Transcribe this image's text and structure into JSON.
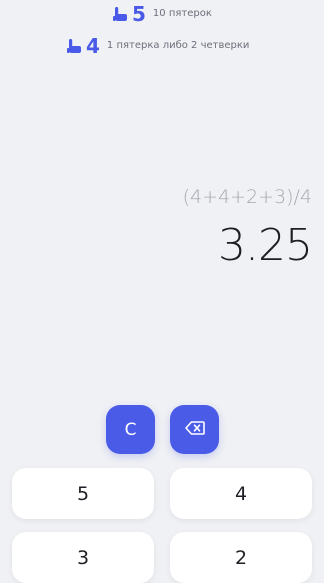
{
  "hints": [
    {
      "grade": "5",
      "text": "10 пятерок"
    },
    {
      "grade": "4",
      "text": "1 пятерка либо 2 четверки"
    }
  ],
  "display": {
    "expression": "(4+4+2+3)/4",
    "result": "3.25"
  },
  "actions": {
    "clear_label": "C",
    "backspace_icon": "backspace-icon"
  },
  "keypad": {
    "keys": [
      "5",
      "4",
      "3",
      "2"
    ]
  },
  "colors": {
    "accent": "#4a5be8",
    "background": "#f0f1f4",
    "key_background": "#ffffff",
    "result_text": "#1d1f24",
    "expression_text": "#a6a9b1"
  }
}
